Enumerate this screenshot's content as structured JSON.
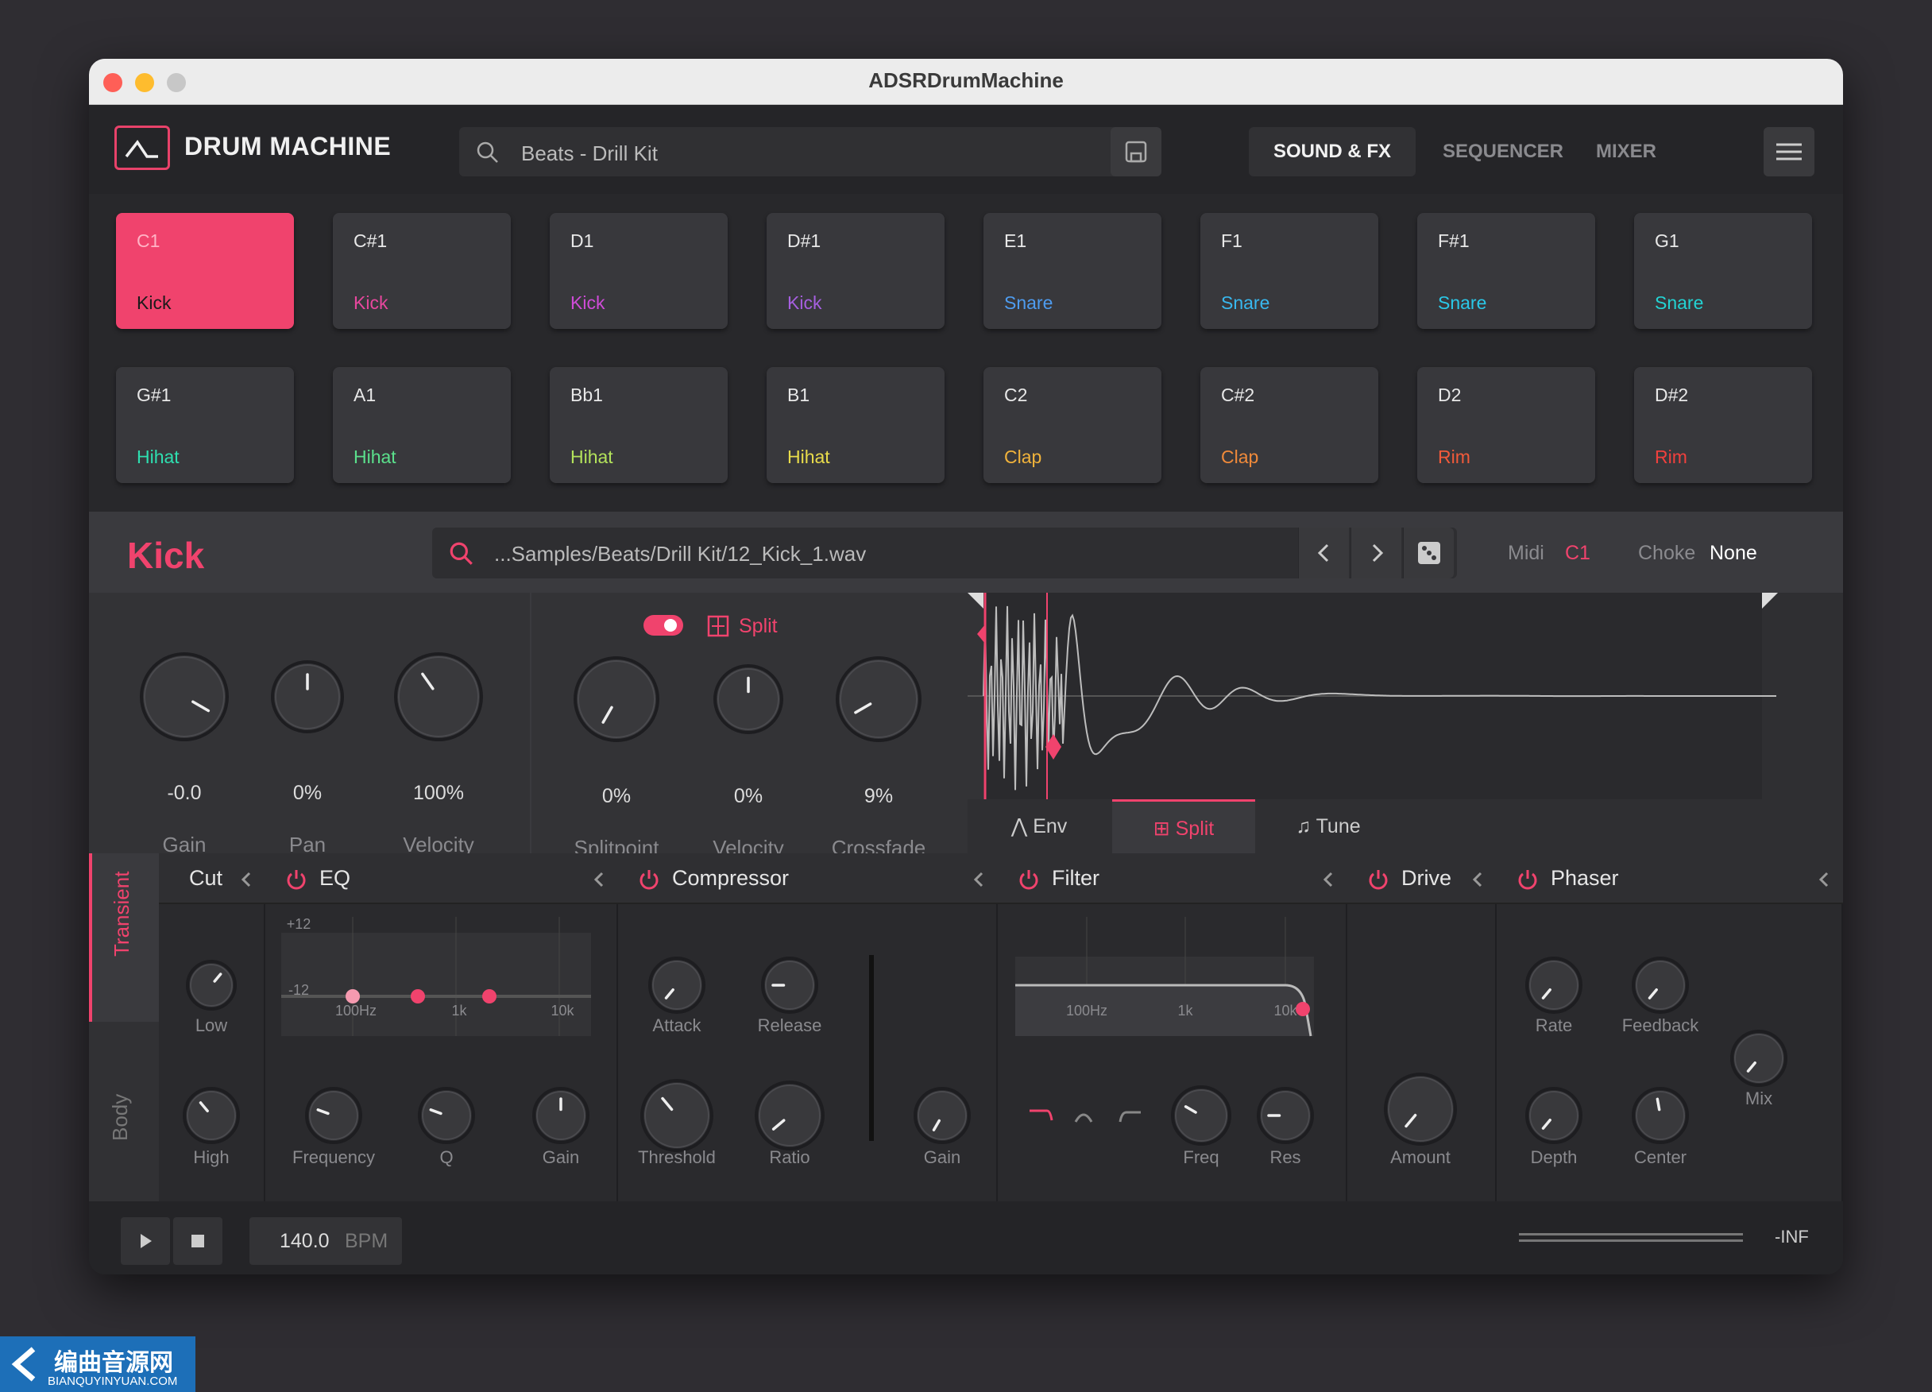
{
  "window": {
    "title": "ADSRDrumMachine"
  },
  "header": {
    "app_name": "DRUM MACHINE",
    "preset": "Beats - Drill Kit",
    "tabs": [
      "SOUND & FX",
      "SEQUENCER",
      "MIXER"
    ],
    "active_tab": "SOUND & FX"
  },
  "pads": [
    {
      "note": "C1",
      "sound": "Kick",
      "color": "#1a1a1a",
      "selected": true
    },
    {
      "note": "C#1",
      "sound": "Kick",
      "color": "#e8479e"
    },
    {
      "note": "D1",
      "sound": "Kick",
      "color": "#cf4bd8"
    },
    {
      "note": "D#1",
      "sound": "Kick",
      "color": "#a65fe0"
    },
    {
      "note": "E1",
      "sound": "Snare",
      "color": "#4e9cf0"
    },
    {
      "note": "F1",
      "sound": "Snare",
      "color": "#38b8ef"
    },
    {
      "note": "F#1",
      "sound": "Snare",
      "color": "#2ac8e8"
    },
    {
      "note": "G1",
      "sound": "Snare",
      "color": "#23d3d3"
    },
    {
      "note": "G#1",
      "sound": "Hihat",
      "color": "#2edfb0"
    },
    {
      "note": "A1",
      "sound": "Hihat",
      "color": "#5be08c"
    },
    {
      "note": "Bb1",
      "sound": "Hihat",
      "color": "#b3e25b"
    },
    {
      "note": "B1",
      "sound": "Hihat",
      "color": "#e9dc4b"
    },
    {
      "note": "C2",
      "sound": "Clap",
      "color": "#f1b33b"
    },
    {
      "note": "C#2",
      "sound": "Clap",
      "color": "#f08a3a"
    },
    {
      "note": "D2",
      "sound": "Rim",
      "color": "#f15a3a"
    },
    {
      "note": "D#2",
      "sound": "Rim",
      "color": "#f1403d"
    }
  ],
  "instrument": {
    "name": "Kick",
    "sample_path": "...Samples/Beats/Drill Kit/12_Kick_1.wav",
    "midi_label": "Midi",
    "midi_value": "C1",
    "choke_label": "Choke",
    "choke_value": "None",
    "knobs": [
      {
        "label": "Gain",
        "value": "-0.0"
      },
      {
        "label": "Pan",
        "value": "0%"
      },
      {
        "label": "Velocity",
        "value": "100%"
      }
    ],
    "split": {
      "label": "Split",
      "enabled": true,
      "knobs": [
        {
          "label": "Splitpoint",
          "value": "0%"
        },
        {
          "label": "Velocity",
          "value": "0%"
        },
        {
          "label": "Crossfade",
          "value": "9%"
        }
      ]
    },
    "wave_tabs": [
      "Env",
      "Split",
      "Tune"
    ],
    "active_wave_tab": "Split"
  },
  "fx": {
    "side_tabs": [
      "Transient",
      "Body"
    ],
    "cut": {
      "title": "Cut",
      "knobs": [
        "Low",
        "High"
      ]
    },
    "eq": {
      "title": "EQ",
      "db_top": "+12",
      "db_bottom": "-12",
      "freqs": [
        "100Hz",
        "1k",
        "10k"
      ],
      "knobs": [
        "Frequency",
        "Q",
        "Gain"
      ]
    },
    "compressor": {
      "title": "Compressor",
      "knobs": [
        "Attack",
        "Release",
        "Threshold",
        "Ratio",
        "Gain"
      ]
    },
    "filter": {
      "title": "Filter",
      "freqs": [
        "100Hz",
        "1k",
        "10k"
      ],
      "knobs": [
        "Freq",
        "Res"
      ]
    },
    "drive": {
      "title": "Drive",
      "knobs": [
        "Amount"
      ]
    },
    "phaser": {
      "title": "Phaser",
      "knobs": [
        "Rate",
        "Feedback",
        "Depth",
        "Center",
        "Mix"
      ]
    }
  },
  "transport": {
    "bpm": "140.0",
    "bpm_unit": "BPM",
    "level": "-INF"
  },
  "colors": {
    "accent": "#f0436d"
  },
  "watermark": {
    "cn": "编曲音源网",
    "en": "BIANQUYINYUAN.COM"
  }
}
